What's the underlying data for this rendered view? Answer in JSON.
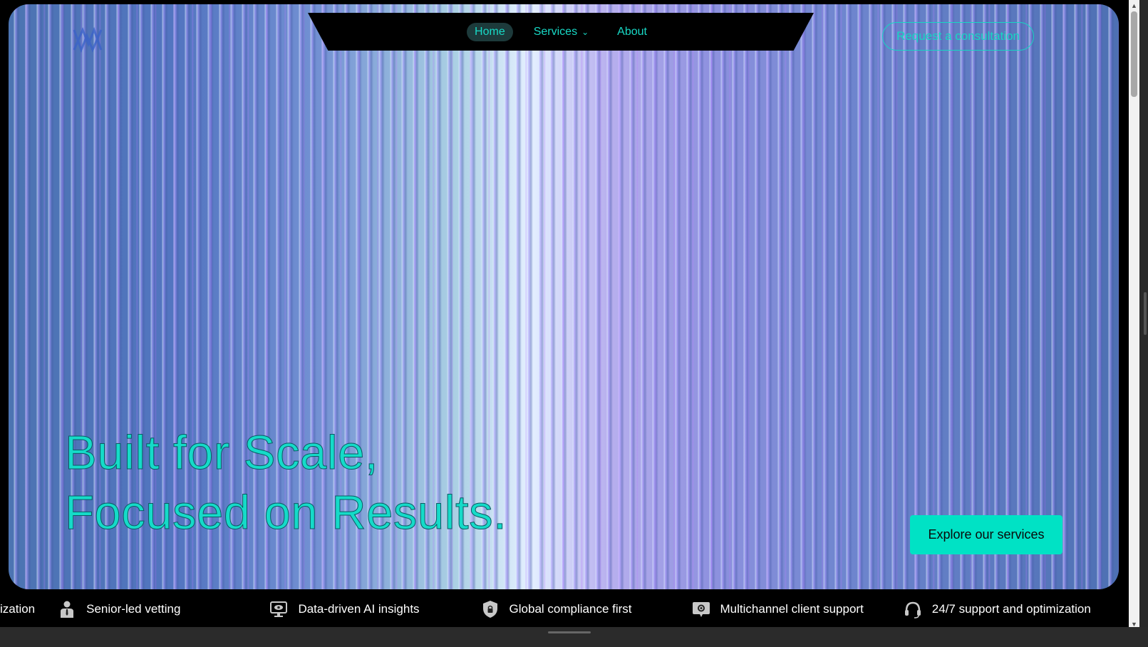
{
  "nav": {
    "items": [
      {
        "label": "Home",
        "active": true
      },
      {
        "label": "Services",
        "has_dropdown": true
      },
      {
        "label": "About"
      }
    ],
    "cta_label": "Request a consultation"
  },
  "hero": {
    "headline_line1": "Built for Scale,",
    "headline_line2": "Focused on Results.",
    "button_label": "Explore our services"
  },
  "ticker": {
    "items": [
      {
        "label": "ization",
        "icon": "none"
      },
      {
        "label": "Senior-led vetting",
        "icon": "person-icon"
      },
      {
        "label": "Data-driven AI insights",
        "icon": "monitor-eye-icon"
      },
      {
        "label": "Global compliance first",
        "icon": "shield-lock-icon"
      },
      {
        "label": "Multichannel client support",
        "icon": "gear-chat-icon"
      },
      {
        "label": "24/7 support and optimization",
        "icon": "headset-icon"
      }
    ]
  },
  "colors": {
    "accent": "#15DBC8",
    "button": "#00E2C5",
    "nav_bg": "#000000",
    "page_bg": "#000000"
  }
}
